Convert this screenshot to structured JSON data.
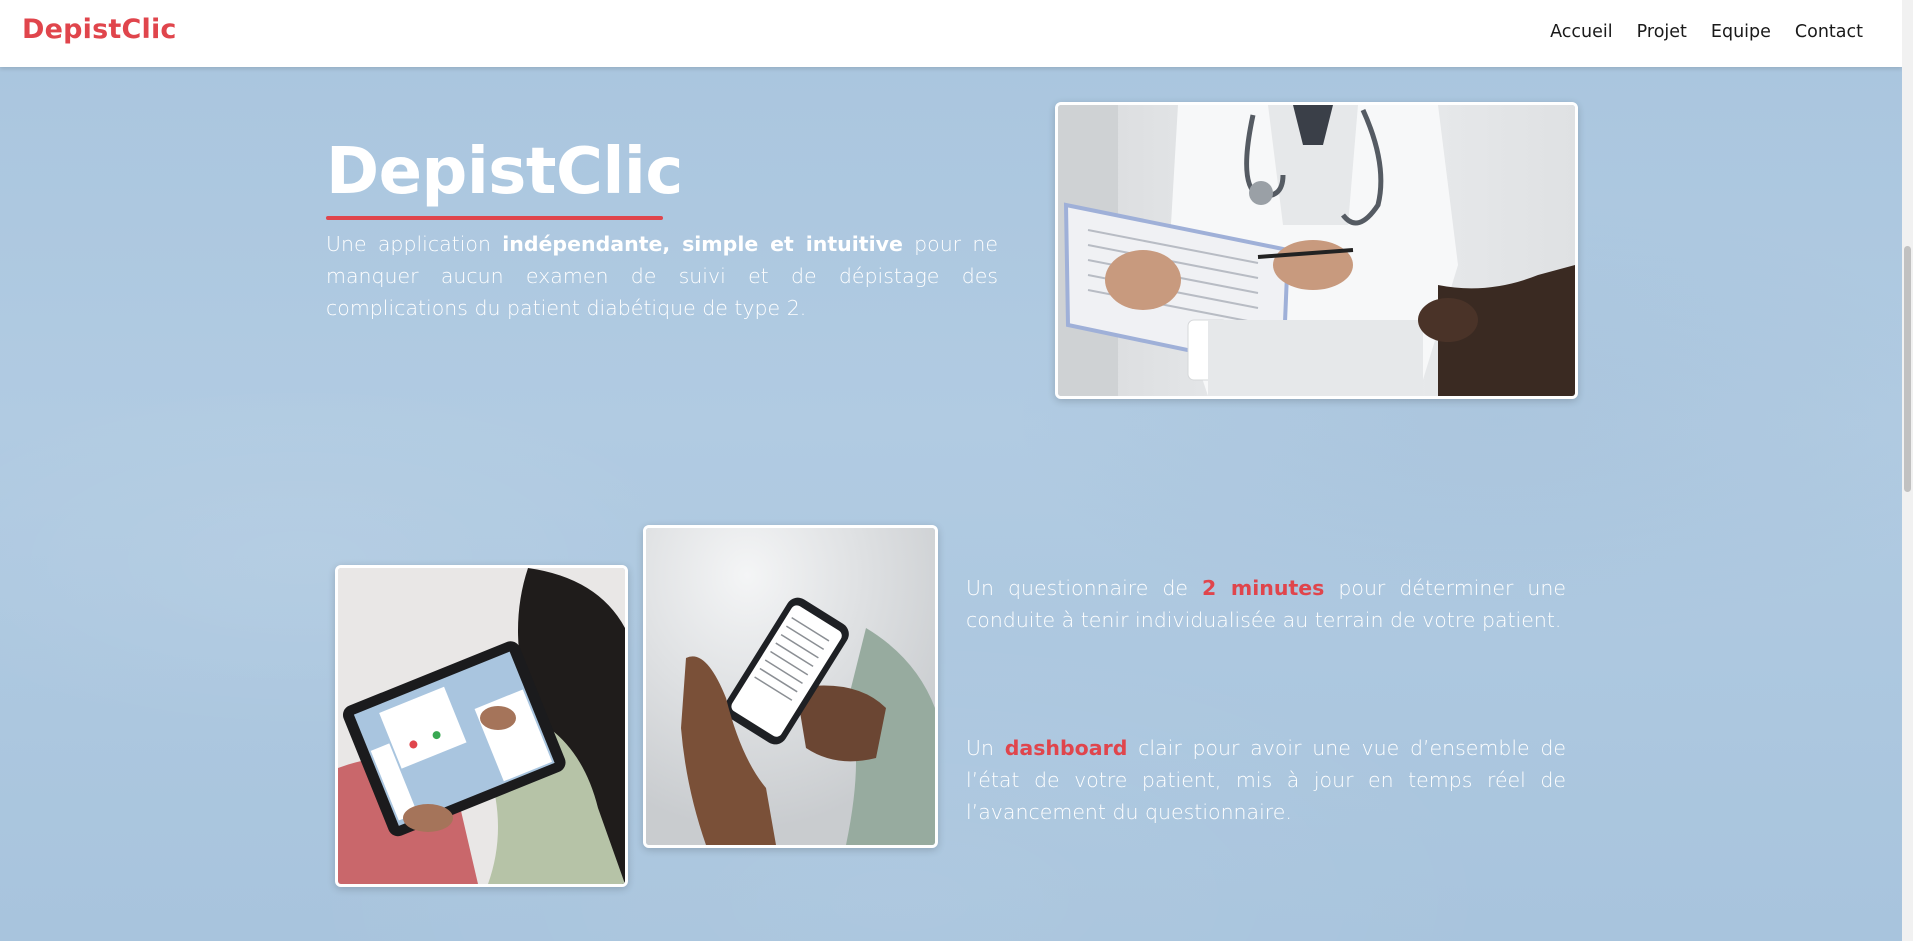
{
  "header": {
    "logo": "DepistClic",
    "nav": [
      {
        "label": "Accueil"
      },
      {
        "label": "Projet"
      },
      {
        "label": "Equipe"
      },
      {
        "label": "Contact"
      }
    ]
  },
  "hero": {
    "title": "DepistClic",
    "description": {
      "part1": "Une application ",
      "bold": "indépendante, simple et intuitive",
      "part2": " pour ne manquer aucun examen de suivi et de dépistage des complications du patient diabétique de type 2."
    }
  },
  "features": {
    "questionnaire": {
      "part1": "Un questionnaire de ",
      "accent": "2 minutes",
      "part2": " pour déterminer une conduite à tenir individualisée au terrain de votre patient."
    },
    "dashboard": {
      "part1": "Un ",
      "accent": "dashboard",
      "part2": " clair pour avoir une vue d’ensemble de l’état de votre patient, mis à jour en temps réel de l’avancement du questionnaire."
    }
  },
  "colors": {
    "brand": "#e0454c",
    "background": "#aec8e0",
    "text": "#ffffff"
  },
  "images": {
    "doctor_photo": "doctor-with-clipboard-photo",
    "tablet_photo": "woman-using-tablet-photo",
    "phone_photo": "hands-holding-phone-photo"
  }
}
